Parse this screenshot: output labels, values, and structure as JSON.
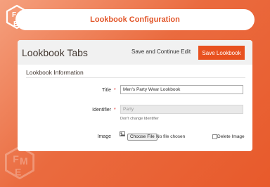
{
  "header": {
    "title": "Lookbook Configuration"
  },
  "logo": {
    "icon": "fme-logo-icon",
    "letters": "FME"
  },
  "colors": {
    "accent": "#e8511f",
    "required": "#e22626",
    "header_text": "#e2562a"
  },
  "page": {
    "title": "Lookbook Tabs",
    "save_continue_label": "Save and Continue Edit",
    "save_label": "Save Lookbook"
  },
  "section": {
    "title": "Lookbook Information"
  },
  "form": {
    "title": {
      "label": "Title",
      "required": "*",
      "value": "Men's Party Wear Lookbook"
    },
    "identifier": {
      "label": "Identifier",
      "required": "*",
      "value": "Party",
      "note": "Don't change Identifier"
    },
    "image": {
      "label": "Image",
      "choose_label": "Choose File",
      "file_status": "No file chosen",
      "delete_label": "Delete Image",
      "icon": "image-icon"
    }
  }
}
